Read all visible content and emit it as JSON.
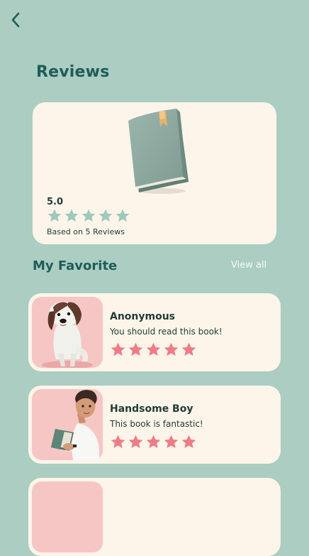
{
  "header": {
    "back_icon": "chevron-left-icon",
    "title": "Reviews"
  },
  "summary": {
    "image_icon": "book-icon",
    "rating": "5.0",
    "stars_filled": 5,
    "stars_total": 5,
    "review_count_text": "Based on 5 Reviews"
  },
  "favorites": {
    "title": "My Favorite",
    "view_all_label": "View all",
    "reviews": [
      {
        "avatar_icon": "dog-avatar-icon",
        "name": "Anonymous",
        "text": "You should read this book!",
        "stars_filled": 5,
        "stars_total": 5
      },
      {
        "avatar_icon": "boy-with-book-avatar-icon",
        "name": "Handsome Boy",
        "text": "This book is fantastic!",
        "stars_filled": 5,
        "stars_total": 5
      }
    ]
  },
  "colors": {
    "background": "#abcdc2",
    "card": "#fdf5e9",
    "heading": "#1f5d57",
    "text": "#1f3b37",
    "summary_star": "#9fc9bd",
    "review_star": "#f07b86",
    "avatar_background": "#f6c6c4"
  }
}
